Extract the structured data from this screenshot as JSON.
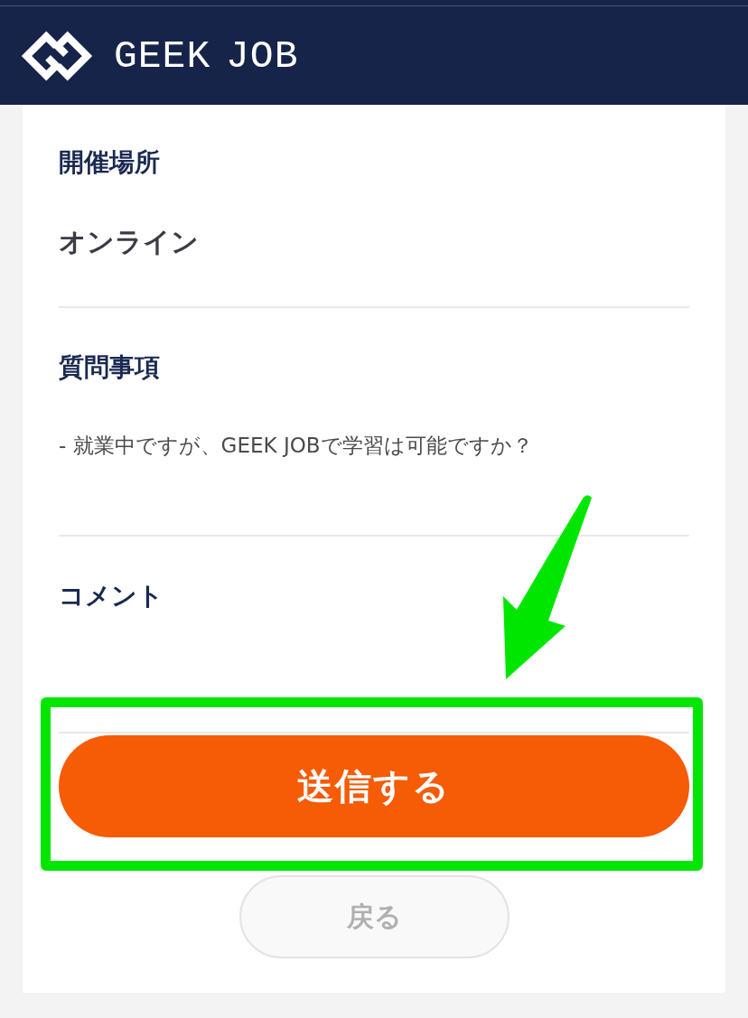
{
  "header": {
    "logo_text": "GEEK JOB"
  },
  "sections": [
    {
      "kind": "text",
      "heading": "開催場所",
      "value": "オンライン"
    },
    {
      "kind": "list",
      "heading": "質問事項",
      "value": "- 就業中ですが、GEEK JOBで学習は可能ですか？"
    },
    {
      "heading": "コメント"
    }
  ],
  "submit_button": {
    "label": "送信する",
    "highlighted": true
  },
  "back_button": {
    "label": "戻る",
    "disabled": true
  },
  "annotations": [
    {
      "kind": "arrow"
    }
  ]
}
